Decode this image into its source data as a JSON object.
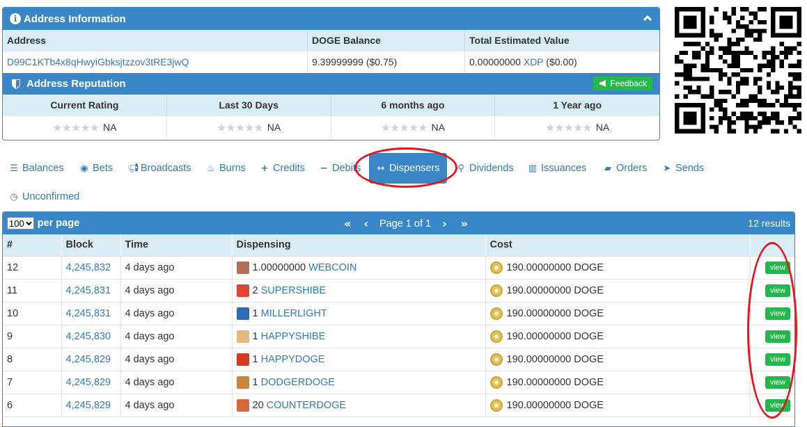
{
  "address_panel": {
    "title": "Address Information",
    "columns": [
      "Address",
      "DOGE Balance",
      "Total Estimated Value"
    ],
    "address": "D99C1KTb4x8qHwyiGbksjtzzov3tRE3jwQ",
    "balance": "9.39999999 ($0.75)",
    "value_amount": "0.00000000",
    "value_asset": "XDP",
    "value_usd": "($0.00)"
  },
  "reputation": {
    "title": "Address Reputation",
    "feedback_label": "Feedback",
    "columns": [
      "Current Rating",
      "Last 30 Days",
      "6 months ago",
      "1 Year ago"
    ],
    "ratings": [
      "NA",
      "NA",
      "NA",
      "NA"
    ],
    "stars": "★★★★★"
  },
  "tabs": [
    {
      "label": "Balances",
      "icon": "list-icon"
    },
    {
      "label": "Bets",
      "icon": "target-icon"
    },
    {
      "label": "Broadcasts",
      "icon": "bullhorn-icon"
    },
    {
      "label": "Burns",
      "icon": "fire-icon"
    },
    {
      "label": "Credits",
      "icon": "plus-icon"
    },
    {
      "label": "Debits",
      "icon": "minus-icon"
    },
    {
      "label": "Dispensers",
      "icon": "arrows-h-icon",
      "active": true
    },
    {
      "label": "Dividends",
      "icon": "sitemap-icon"
    },
    {
      "label": "Issuances",
      "icon": "bank-icon"
    },
    {
      "label": "Orders",
      "icon": "book-icon"
    },
    {
      "label": "Sends",
      "icon": "send-icon"
    },
    {
      "label": "Unconfirmed",
      "icon": "clock-icon"
    }
  ],
  "results_panel": {
    "per_page_value": "100",
    "per_page_label": "per page",
    "page_text": "Page 1 of 1",
    "results_text": "12 results",
    "columns": [
      "#",
      "Block",
      "Time",
      "Dispensing",
      "Cost",
      ""
    ],
    "view_label": "view",
    "rows": [
      {
        "num": "12",
        "block": "4,245,832",
        "time": "4 days ago",
        "qty": "1.00000000",
        "asset": "WEBCOIN",
        "cost": "190.00000000 DOGE",
        "icon_color": "#b6705a"
      },
      {
        "num": "11",
        "block": "4,245,831",
        "time": "4 days ago",
        "qty": "2",
        "asset": "SUPERSHIBE",
        "cost": "190.00000000 DOGE",
        "icon_color": "#e2452f"
      },
      {
        "num": "10",
        "block": "4,245,831",
        "time": "4 days ago",
        "qty": "1",
        "asset": "MILLERLIGHT",
        "cost": "190.00000000 DOGE",
        "icon_color": "#2f6db5"
      },
      {
        "num": "9",
        "block": "4,245,830",
        "time": "4 days ago",
        "qty": "1",
        "asset": "HAPPYSHIBE",
        "cost": "190.00000000 DOGE",
        "icon_color": "#e6b97a"
      },
      {
        "num": "8",
        "block": "4,245,829",
        "time": "4 days ago",
        "qty": "1",
        "asset": "HAPPYDOGE",
        "cost": "190.00000000 DOGE",
        "icon_color": "#d9391f"
      },
      {
        "num": "7",
        "block": "4,245,829",
        "time": "4 days ago",
        "qty": "1",
        "asset": "DODGERDOGE",
        "cost": "190.00000000 DOGE",
        "icon_color": "#c9853a"
      },
      {
        "num": "6",
        "block": "4,245,829",
        "time": "4 days ago",
        "qty": "20",
        "asset": "COUNTERDOGE",
        "cost": "190.00000000 DOGE",
        "icon_color": "#d46a3a"
      }
    ]
  },
  "colors": {
    "primary": "#3a87c8",
    "header_light": "#d9edf7",
    "link": "#337ab7",
    "success": "#22b84b",
    "annotation": "#e8141c"
  }
}
